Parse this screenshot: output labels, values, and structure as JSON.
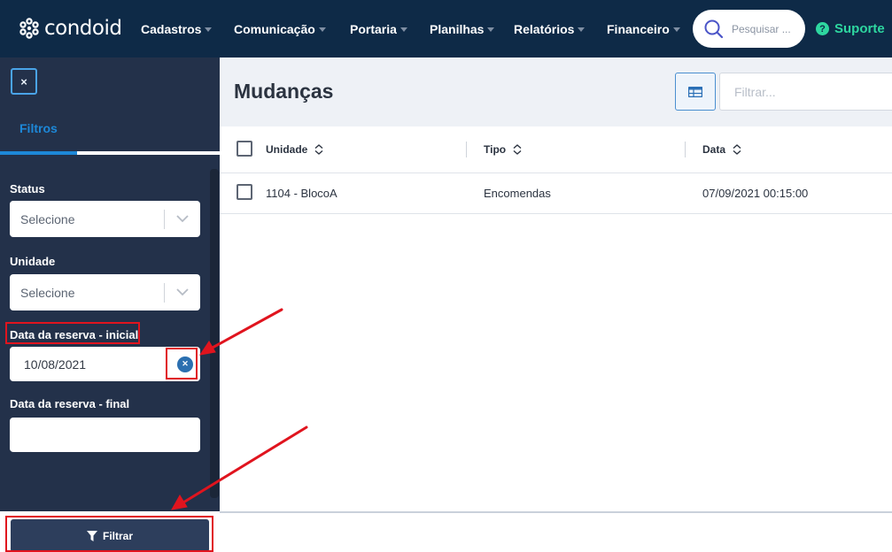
{
  "topbar": {
    "logo_text": "condoid",
    "nav": [
      {
        "label": "Cadastros"
      },
      {
        "label": "Comunicação"
      },
      {
        "label": "Portaria"
      },
      {
        "label": "Planilhas"
      },
      {
        "label": "Relatórios"
      },
      {
        "label": "Financeiro"
      }
    ],
    "search_placeholder": "Pesquisar ...",
    "support_label": "Suporte"
  },
  "sidebar": {
    "close_label": "×",
    "tab_label": "Filtros",
    "fields": {
      "status_label": "Status",
      "status_value": "Selecione",
      "unidade_label": "Unidade",
      "unidade_value": "Selecione",
      "data_inicial_label": "Data da reserva - inicial",
      "data_inicial_value": "10/08/2021",
      "data_final_label": "Data da reserva - final",
      "data_final_value": ""
    },
    "filter_button": "Filtrar"
  },
  "main": {
    "title": "Mudanças",
    "filter_placeholder": "Filtrar...",
    "columns": [
      "Unidade",
      "Tipo",
      "Data"
    ],
    "rows": [
      {
        "unidade": "1104 - BlocoA",
        "tipo": "Encomendas",
        "data": "07/09/2021 00:15:00"
      }
    ]
  },
  "colors": {
    "topbar": "#0e2a47",
    "sidebar": "#23314a",
    "accent": "#1d88d8",
    "support": "#2ed7a0",
    "annotation": "#e0141e"
  }
}
